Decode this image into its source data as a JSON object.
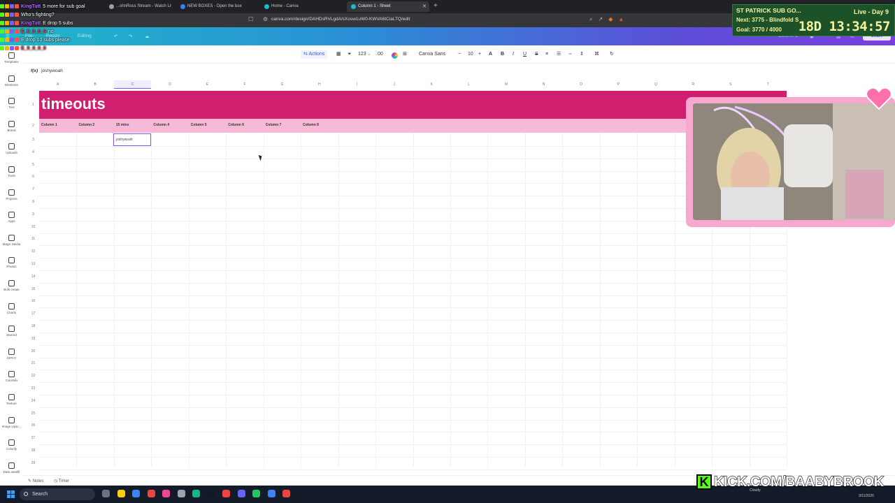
{
  "browser": {
    "tabs": [
      {
        "label": "...ohnRoss Stream - Watch Live on Ki...",
        "active": false
      },
      {
        "label": "NEW BOXES - Open the box",
        "active": false
      },
      {
        "label": "Home - Canva",
        "active": false
      },
      {
        "label": "Column 1 - Sheet",
        "active": true
      }
    ],
    "url": "canva.com/design/DAHDsRVLgdA/sXosw1uW0-KWVA6tCiaLTQ/edit"
  },
  "canva": {
    "menu": [
      "File",
      "Resize",
      "Editing"
    ],
    "doc_name": "Column 1",
    "share_label": "Share"
  },
  "toolbar": {
    "actions_label": "Actions",
    "number_format": "123",
    "decimals": ".00",
    "font_name": "Canva Sans",
    "font_size": "10",
    "minus": "−",
    "plus": "+"
  },
  "sidebar": {
    "items": [
      "Templates",
      "Elements",
      "Text",
      "Brand",
      "Uploads",
      "Tools",
      "Projects",
      "Apps",
      "Magic Media",
      "Photos",
      "Bulk create",
      "Charts",
      "Starred",
      "GIPHY",
      "ColorMix",
      "Texture",
      "Image Upsc...",
      "Colorify",
      "Data autofill"
    ]
  },
  "formula_bar": {
    "fx": "f(x)",
    "value": "joshywoah"
  },
  "sheet": {
    "columns": [
      "A",
      "B",
      "C",
      "D",
      "E",
      "F",
      "G",
      "H",
      "I",
      "J",
      "K",
      "L",
      "M",
      "N",
      "O",
      "P",
      "Q",
      "R",
      "S",
      "T"
    ],
    "selected_column": "C",
    "rows": [
      "1",
      "2",
      "3",
      "4",
      "5",
      "6",
      "7",
      "8",
      "9",
      "10",
      "11",
      "12",
      "13",
      "14",
      "15",
      "16",
      "17",
      "18",
      "19",
      "20",
      "21",
      "22",
      "23",
      "24",
      "25",
      "26",
      "27",
      "28",
      "29"
    ],
    "title": "timeouts",
    "headers": [
      "Column 1",
      "Column 2",
      "15 mins",
      "Column 4",
      "Column 5",
      "Column 6",
      "Column 7",
      "Column 8"
    ],
    "selected_cell_value": "joshywoah",
    "colors": {
      "banner": "#d11f6f",
      "header_row": "#f8b9d6",
      "selection": "#7c5cf0"
    }
  },
  "bottom": {
    "notes": "Notes",
    "timer": "Timer"
  },
  "taskbar": {
    "search_placeholder": "Search",
    "weather": "Cloudy",
    "date": "3/11/2026"
  },
  "overlay": {
    "chat": [
      {
        "user": "KingTutt",
        "message": "5 more for sub goal",
        "color": "#b76bff"
      },
      {
        "user": "",
        "message": "Who's fighting?",
        "color": "#ffffff"
      },
      {
        "user": "KingTutt",
        "message": "E drop 5 subs",
        "color": "#b76bff"
      },
      {
        "user": "E_9_0_0_0",
        "message": "no",
        "color": "#ff4d4d"
      },
      {
        "user": "",
        "message": "E drop 10 subs please",
        "color": "#ffffff"
      },
      {
        "user": "E_9_0_0_0",
        "message": "",
        "color": "#ff4d4d"
      }
    ],
    "subgoal": {
      "title": "ST PATRICK SUB GO...",
      "next": "Next: 3775 - Blindfold S",
      "goal": "Goal: 3770 / 4000",
      "live_day": "Live - Day 9",
      "timer": "18D 13:34:57"
    },
    "kick_handle": "KICK.COM/BAABYBROOK"
  }
}
